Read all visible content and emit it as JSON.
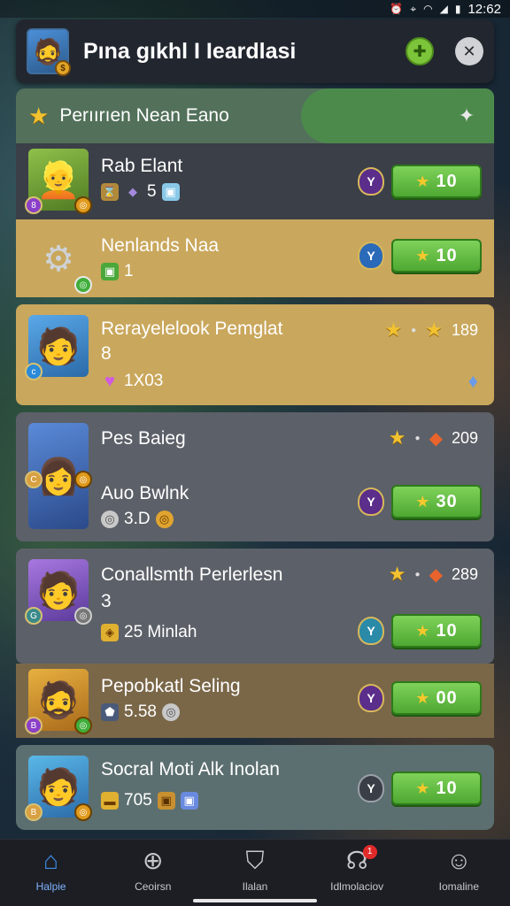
{
  "status_bar": {
    "time": "12:62"
  },
  "header": {
    "title": "Pına gıkhl I Ieardlasi"
  },
  "section": {
    "title": "Perıırıen Nean Eano"
  },
  "rows": [
    {
      "name": "Rab Elant",
      "sub_value": "5",
      "reward": "10",
      "style": "dark"
    },
    {
      "name": "Nenlands Naa",
      "sub_value": "1",
      "reward": "10",
      "style": "gold"
    },
    {
      "name": "Rerayelelook Pemglat",
      "line2": "8",
      "sub_value": "1X03",
      "stat_value": "189",
      "style": "gold"
    },
    {
      "name": "Pes Baieg",
      "stat_value": "209",
      "name2": "Auo Bwlnk",
      "sub_value": "3.D",
      "reward": "30",
      "style": "gray"
    },
    {
      "name": "Conallsmth Perlerlesn",
      "line2": "3",
      "stat_value": "289",
      "sub_value": "25 Minlah",
      "reward": "10",
      "style": "gray"
    },
    {
      "name": "Pepobkatl Seling",
      "sub_value": "5.58",
      "reward": "00",
      "style": "brown"
    },
    {
      "name": "Socral Moti Alk Inolan",
      "sub_value": "705",
      "reward": "10",
      "style": "teal"
    }
  ],
  "nav": [
    {
      "label": "Halpie",
      "icon": "home-icon"
    },
    {
      "label": "Ceoirsn",
      "icon": "compass-icon"
    },
    {
      "label": "Ilalan",
      "icon": "cup-icon"
    },
    {
      "label": "Idlmolaciov",
      "icon": "chat-icon",
      "badge": "1"
    },
    {
      "label": "Iomaline",
      "icon": "profile-icon"
    }
  ]
}
